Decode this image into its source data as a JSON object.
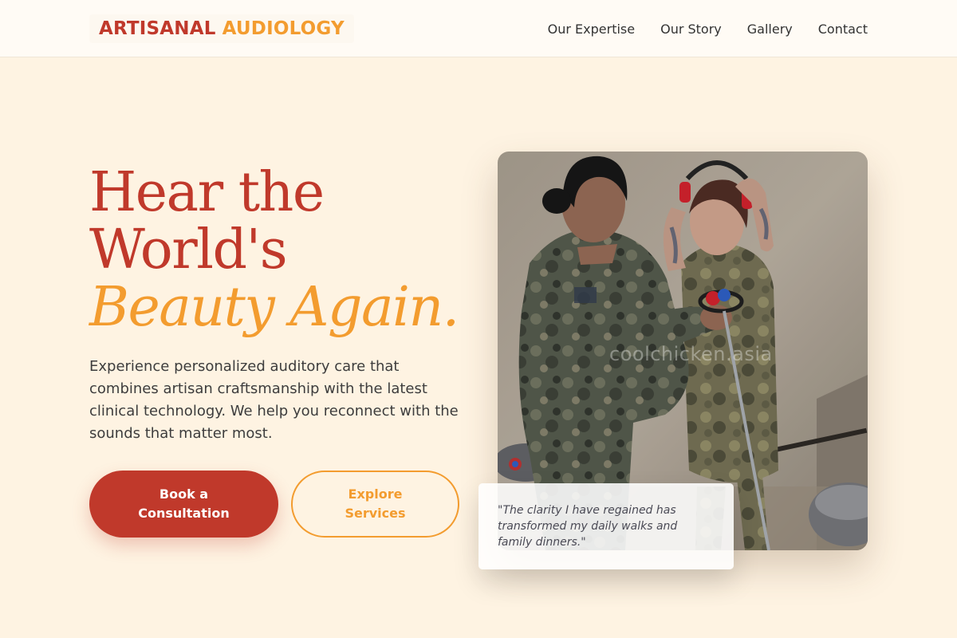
{
  "header": {
    "logo_part1": "ARTISANAL",
    "logo_part2": "AUDIOLOGY",
    "nav": [
      {
        "label": "Our Expertise"
      },
      {
        "label": "Our Story"
      },
      {
        "label": "Gallery"
      },
      {
        "label": "Contact"
      }
    ]
  },
  "hero": {
    "title_line1": "Hear the",
    "title_line2": "World's",
    "title_accent": "Beauty Again.",
    "description": "Experience personalized auditory care that combines artisan craftsmanship with the latest clinical technology. We help you reconnect with the sounds that matter most.",
    "primary_cta": "Book a Consultation",
    "secondary_cta": "Explore Services",
    "image_watermark": "coolchicken.asia",
    "testimonial": "\"The clarity I have regained has transformed my daily walks and family dinners.\""
  },
  "colors": {
    "brand_red": "#c0392b",
    "brand_orange": "#f39c2f",
    "background": "#fef3e2"
  }
}
